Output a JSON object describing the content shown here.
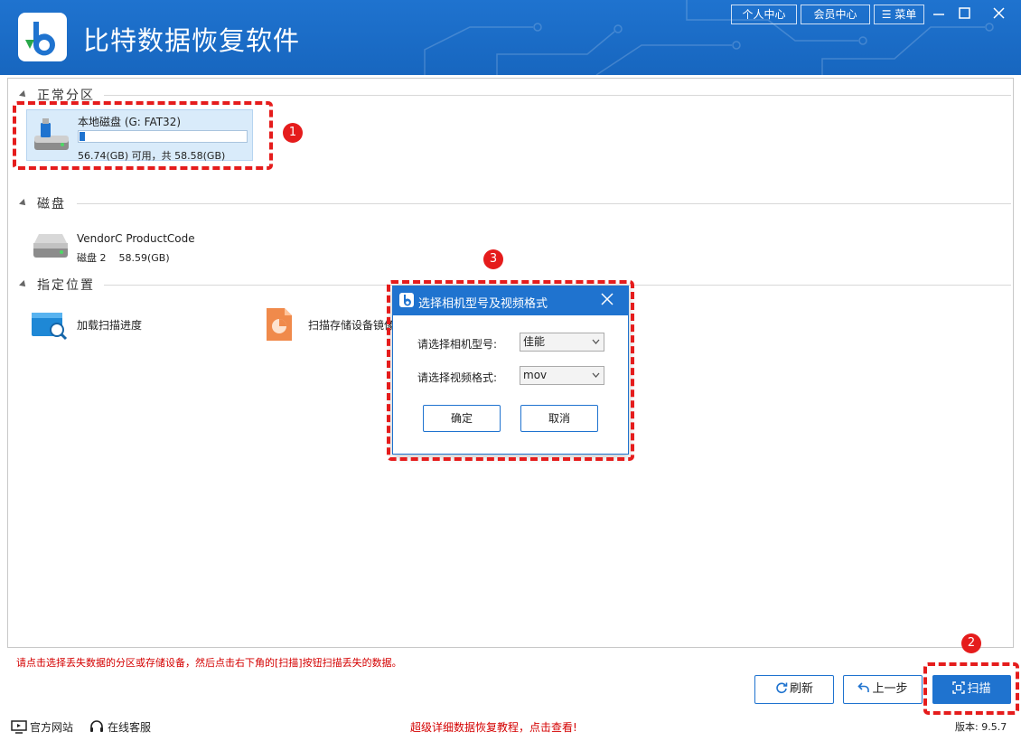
{
  "app": {
    "title": "比特数据恢复软件",
    "header_buttons": {
      "personal": "个人中心",
      "member": "会员中心",
      "menu": "菜单"
    }
  },
  "sections": {
    "partitions": {
      "label": "正常分区",
      "items": [
        {
          "name": "本地磁盘 (G: FAT32)",
          "space": "56.74(GB) 可用，共 58.58(GB)",
          "used_fraction": 0.031
        }
      ]
    },
    "disks": {
      "label": "磁盘",
      "items": [
        {
          "name": "VendorC ProductCode",
          "sub": "磁盘 2",
          "size": "58.59(GB)"
        }
      ]
    },
    "locations": {
      "label": "指定位置",
      "items": [
        {
          "label": "加载扫描进度"
        },
        {
          "label": "扫描存储设备镜像"
        }
      ]
    }
  },
  "dialog": {
    "title": "选择相机型号及视频格式",
    "camera_label": "请选择相机型号:",
    "camera_value": "佳能",
    "format_label": "请选择视频格式:",
    "format_value": "mov",
    "ok_label": "确定",
    "cancel_label": "取消"
  },
  "annotations": {
    "badge1": "1",
    "badge2": "2",
    "badge3": "3",
    "color": "#e51c1c"
  },
  "hint": "请点击选择丢失数据的分区或存储设备，然后点击右下角的[扫描]按钮扫描丢失的数据。",
  "bottom_buttons": {
    "refresh": "刷新",
    "back": "上一步",
    "scan": "扫描"
  },
  "status_bar": {
    "website": "官方网站",
    "support": "在线客服",
    "tutorial": "超级详细数据恢复教程，点击查看!",
    "version": "版本: 9.5.7"
  },
  "colors": {
    "brand": "#1f73cf",
    "panel_selected": "#d9ebfa",
    "hint": "#d40000"
  }
}
